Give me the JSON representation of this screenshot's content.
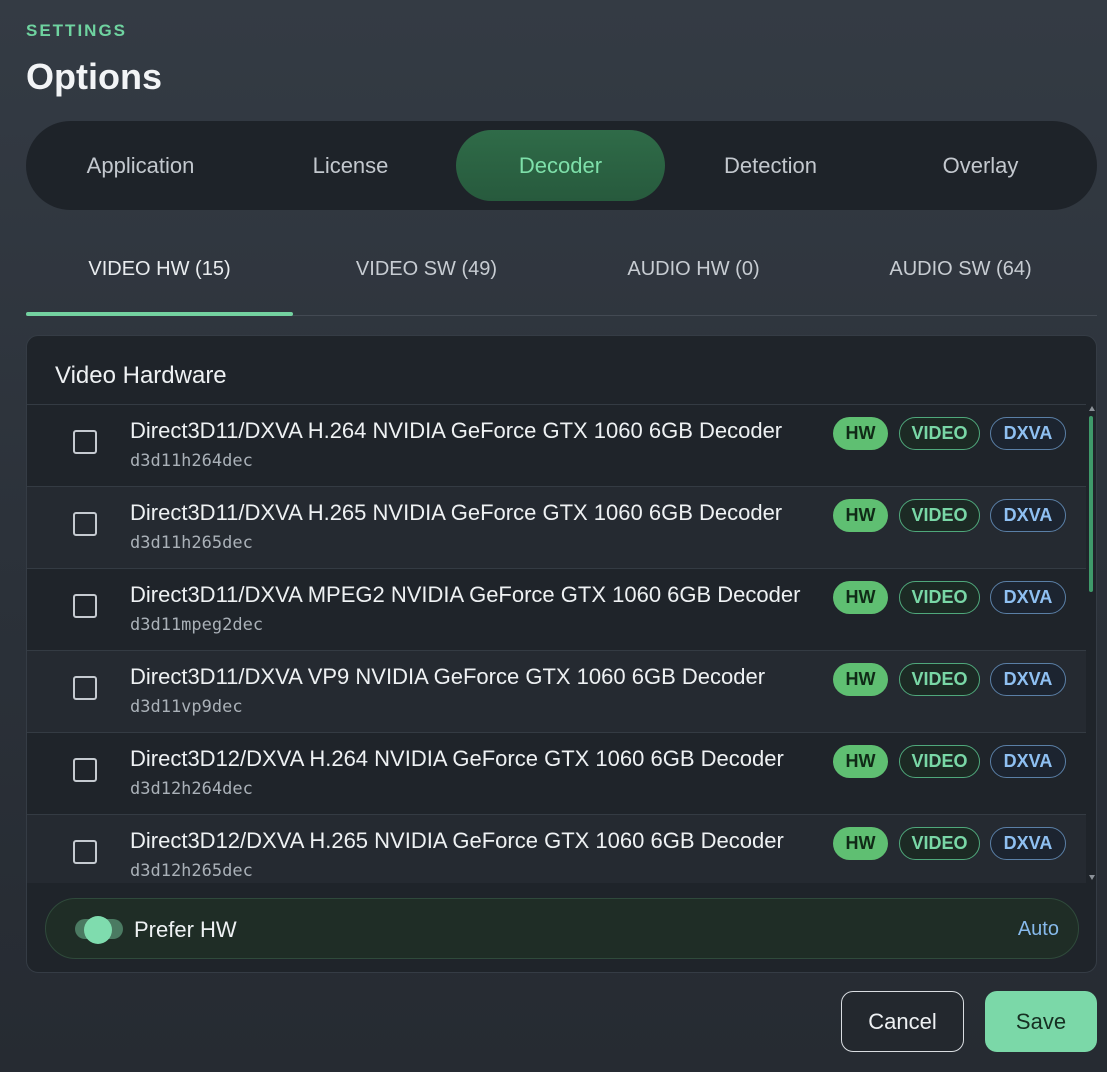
{
  "header": {
    "eyebrow": "SETTINGS",
    "title": "Options"
  },
  "main_tabs": [
    {
      "label": "Application",
      "active": false
    },
    {
      "label": "License",
      "active": false
    },
    {
      "label": "Decoder",
      "active": true
    },
    {
      "label": "Detection",
      "active": false
    },
    {
      "label": "Overlay",
      "active": false
    }
  ],
  "sub_tabs": [
    {
      "label": "VIDEO HW (15)",
      "active": true
    },
    {
      "label": "VIDEO SW (49)",
      "active": false
    },
    {
      "label": "AUDIO HW (0)",
      "active": false
    },
    {
      "label": "AUDIO SW (64)",
      "active": false
    }
  ],
  "panel": {
    "title": "Video Hardware",
    "decoders": [
      {
        "name": "Direct3D11/DXVA H.264 NVIDIA GeForce GTX 1060 6GB Decoder",
        "id": "d3d11h264dec",
        "checked": false,
        "badges": [
          "HW",
          "VIDEO",
          "DXVA"
        ]
      },
      {
        "name": "Direct3D11/DXVA H.265 NVIDIA GeForce GTX 1060 6GB Decoder",
        "id": "d3d11h265dec",
        "checked": false,
        "badges": [
          "HW",
          "VIDEO",
          "DXVA"
        ]
      },
      {
        "name": "Direct3D11/DXVA MPEG2 NVIDIA GeForce GTX 1060 6GB Decoder",
        "id": "d3d11mpeg2dec",
        "checked": false,
        "badges": [
          "HW",
          "VIDEO",
          "DXVA"
        ]
      },
      {
        "name": "Direct3D11/DXVA VP9 NVIDIA GeForce GTX 1060 6GB Decoder",
        "id": "d3d11vp9dec",
        "checked": false,
        "badges": [
          "HW",
          "VIDEO",
          "DXVA"
        ]
      },
      {
        "name": "Direct3D12/DXVA H.264 NVIDIA GeForce GTX 1060 6GB Decoder",
        "id": "d3d12h264dec",
        "checked": false,
        "badges": [
          "HW",
          "VIDEO",
          "DXVA"
        ]
      },
      {
        "name": "Direct3D12/DXVA H.265 NVIDIA GeForce GTX 1060 6GB Decoder",
        "id": "d3d12h265dec",
        "checked": false,
        "badges": [
          "HW",
          "VIDEO",
          "DXVA"
        ]
      }
    ],
    "prefer": {
      "label": "Prefer HW",
      "enabled": true,
      "value": "Auto"
    }
  },
  "footer": {
    "cancel_label": "Cancel",
    "save_label": "Save"
  },
  "colors": {
    "accent": "#73d2a0",
    "background": "#2e343c",
    "panel": "#1f242a",
    "hw_badge": "#5fbf72",
    "dxva_badge": "#8fc0f2"
  }
}
